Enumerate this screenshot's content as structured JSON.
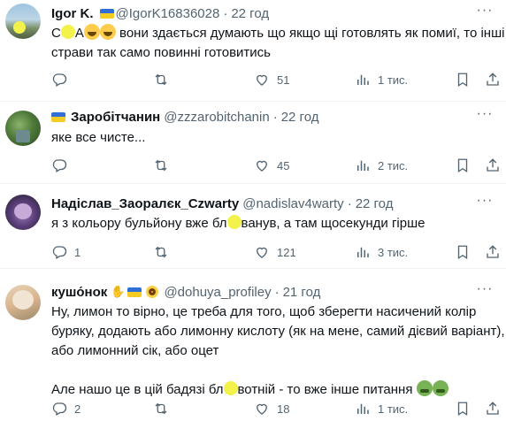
{
  "tweets": [
    {
      "name": "Igor K.",
      "handle": "@IgorK16836028",
      "time": "22 год",
      "text_lines": [
        "С__А😂😂 вони здається думають що якщо щі готовлять як помиї, то інші",
        "страви так само повинні готовитись"
      ],
      "text_a": "С",
      "text_b": "А",
      "text_c": " вони здається думають що якщо щі готовлять як помиї, то інші",
      "text_line2": "страви так само повинні готовитись",
      "replies": "",
      "retweets": "",
      "likes": "51",
      "views": "1 тис."
    },
    {
      "name": "Заробітчанин",
      "handle": "@zzzarobitchanin",
      "time": "22 год",
      "text_line1": "яке все чисте...",
      "replies": "",
      "retweets": "",
      "likes": "45",
      "views": "2 тис."
    },
    {
      "name": "Надіслав_Заоралєк_Czwarty",
      "handle": "@nadislav4warty",
      "time": "22 год",
      "text_a": "я з кольору бульйону вже бл",
      "text_b": "ванув, а там щосекунди гірше",
      "replies": "1",
      "retweets": "",
      "likes": "121",
      "views": "3 тис."
    },
    {
      "name": "кушо́нок",
      "handle": "@dohuya_profiley",
      "time": "21 год",
      "text_line1": "Ну, лимон то вірно, це треба для того, щоб зберегти насичений колір",
      "text_line2": "буряку, додають або лимонну кислоту (як на мене, самий дієвий варіант),",
      "text_line3": "або лимонний сік, або оцет",
      "text_line4a": "Але нашо це в цій бадязі бл",
      "text_line4b": "вотній - то вже інше питання",
      "replies": "2",
      "retweets": "",
      "likes": "18",
      "views": "1 тис."
    }
  ],
  "separator": "·",
  "more_glyph": "···"
}
